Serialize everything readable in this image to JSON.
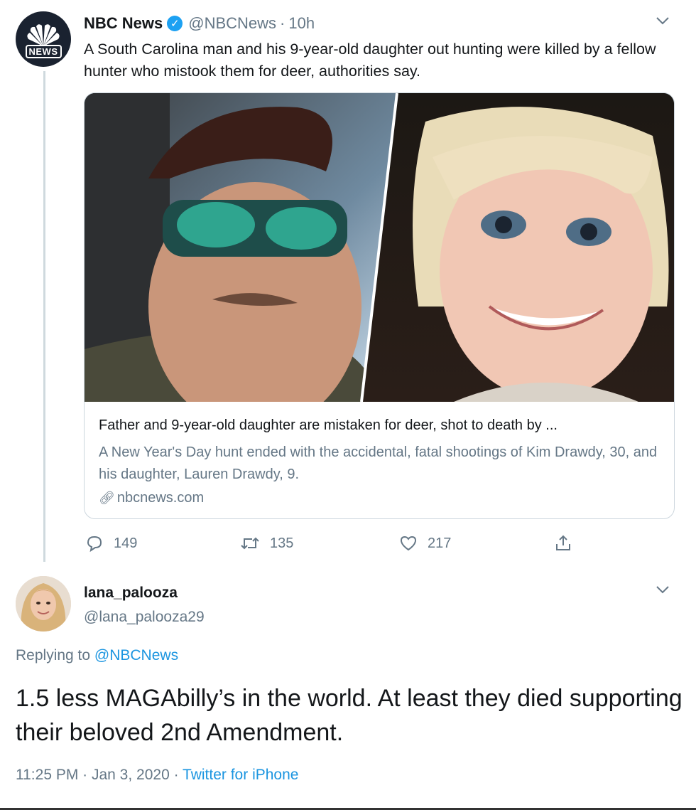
{
  "tweet": {
    "author_name": "NBC News",
    "author_handle": "@NBCNews",
    "separator": "·",
    "time": "10h",
    "avatar_text": "NEWS",
    "text": "A South Carolina man and his 9-year-old daughter out hunting were killed by a fellow hunter who mistook them for deer, authorities say.",
    "card": {
      "title": "Father and 9-year-old daughter are mistaken for deer, shot to death by ...",
      "description": "A New Year's Day hunt ended with the accidental, fatal shootings of Kim Drawdy, 30, and his daughter, Lauren Drawdy, 9.",
      "domain": "nbcnews.com"
    },
    "actions": {
      "replies": "149",
      "retweets": "135",
      "likes": "217"
    }
  },
  "reply": {
    "author_name": "lana_palooza",
    "author_handle": "@lana_palooza29",
    "replying_prefix": "Replying to",
    "replying_handle": "@NBCNews",
    "text": "1.5 less MAGAbilly’s in the world. At least they died supporting their beloved 2nd Amendment.",
    "timestamp": "11:25 PM · Jan 3, 2020 ·",
    "source": "Twitter for iPhone"
  },
  "colors": {
    "text_primary": "#14171a",
    "text_secondary": "#657786",
    "link": "#1b95e0",
    "verified": "#1da1f2"
  }
}
